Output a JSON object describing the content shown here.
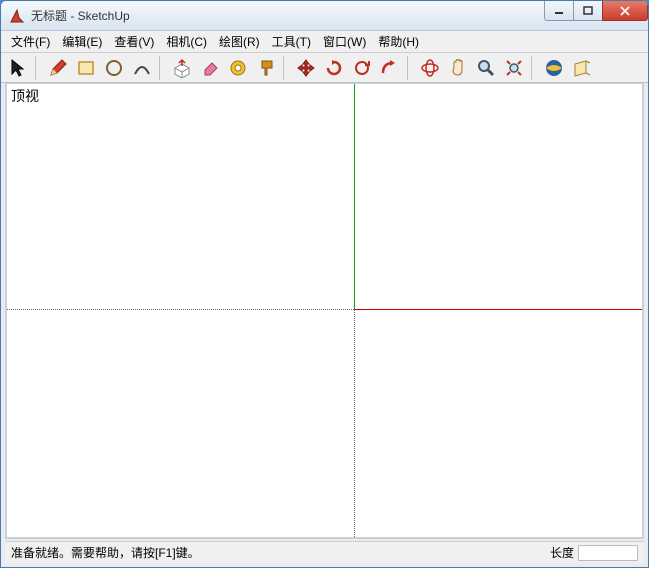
{
  "window": {
    "title": "无标题 - SketchUp"
  },
  "menubar": {
    "items": [
      {
        "label": "文件(F)"
      },
      {
        "label": "编辑(E)"
      },
      {
        "label": "查看(V)"
      },
      {
        "label": "相机(C)"
      },
      {
        "label": "绘图(R)"
      },
      {
        "label": "工具(T)"
      },
      {
        "label": "窗口(W)"
      },
      {
        "label": "帮助(H)"
      }
    ]
  },
  "viewport": {
    "label": "顶视"
  },
  "statusbar": {
    "message": "准备就绪。需要帮助，请按[F1]键。",
    "length_label": "长度"
  }
}
